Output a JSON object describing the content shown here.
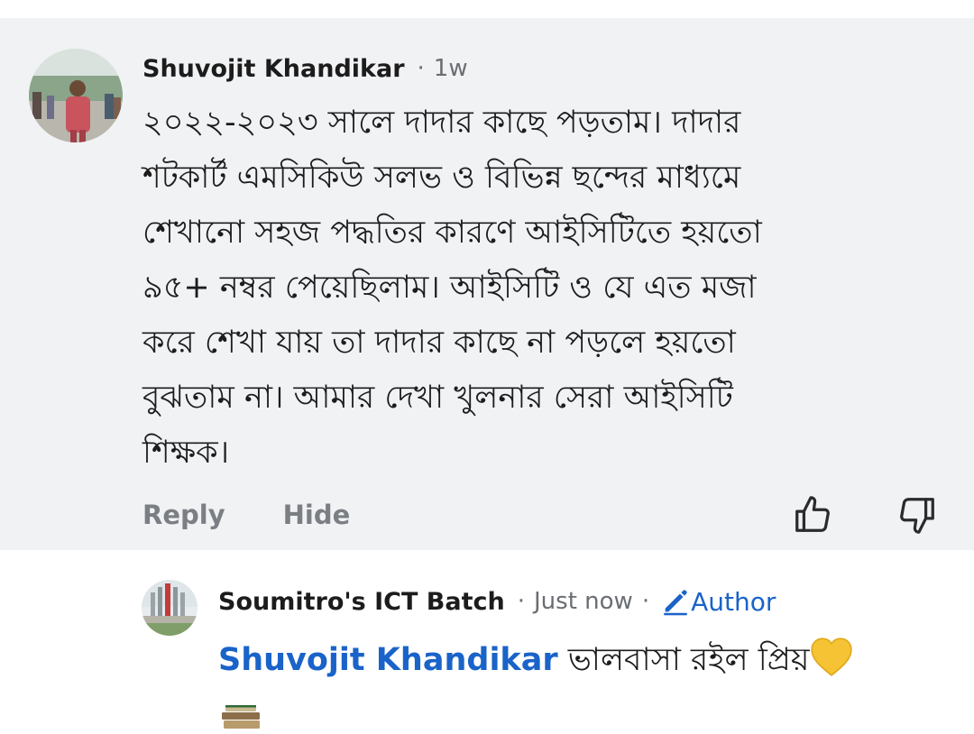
{
  "comment": {
    "author": "Shuvojit Khandikar",
    "separator": "·",
    "time": "1w",
    "text": "২০২২-২০২৩ সালে দাদার কাছে পড়তাম। দাদার\nশটকার্ট এমসিকিউ সলভ ও বিভিন্ন ছন্দের মাধ্যমে\nশেখানো সহজ পদ্ধতির কারণে আইসিটিতে হয়তো\n৯৫+ নম্বর পেয়েছিলাম। আইসিটি ও যে এত মজা\nকরে শেখা যায় তা দাদার কাছে না পড়লে হয়তো\nবুঝতাম না। আমার দেখা খুলনার সেরা আইসিটি\nশিক্ষক।",
    "actions": {
      "reply": "Reply",
      "hide": "Hide"
    },
    "icons": {
      "upvote": "thumbs-up-icon",
      "downvote": "thumbs-down-icon"
    }
  },
  "reply": {
    "author": "Soumitro's ICT Batch",
    "separator": "·",
    "time": "Just now",
    "badge": "Author",
    "mention": "Shuvojit Khandikar",
    "text": " ভালবাসা রইল প্রিয়",
    "emoji": "yellow-heart-icon"
  },
  "colors": {
    "link": "#1a63c9",
    "background": "#f1f2f4",
    "muted": "#7b7f84"
  }
}
